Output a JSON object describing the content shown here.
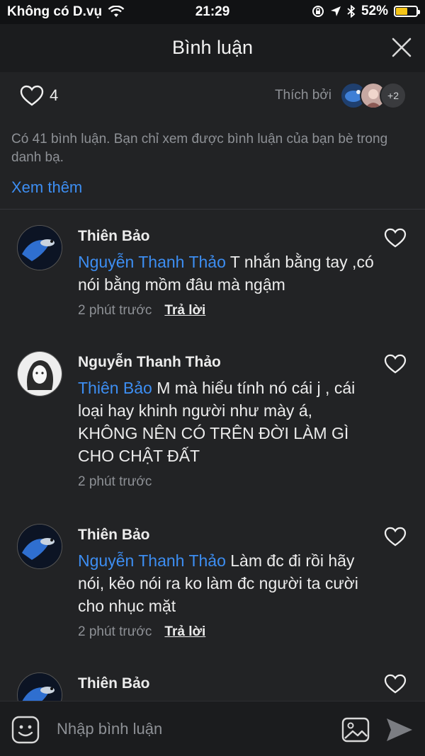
{
  "status_bar": {
    "carrier": "Không có D.vụ",
    "time": "21:29",
    "battery_percent": "52%",
    "battery_level": 0.52
  },
  "header": {
    "title": "Bình luận",
    "close_icon": "close-icon"
  },
  "likes": {
    "count": "4",
    "liked_by_label": "Thích bởi",
    "more_count": "+2"
  },
  "notice": {
    "text": "Có 41 bình luận. Bạn chỉ xem được bình luận của bạn bè trong danh bạ.",
    "see_more": "Xem thêm"
  },
  "comments": [
    {
      "author": "Thiên Bảo",
      "mention": "Nguyễn Thanh Thảo",
      "text": " T nhắn bằng tay ,có nói bằng mồm đâu mà ngậm",
      "time": "2 phút trước",
      "reply": "Trả lời"
    },
    {
      "author": "Nguyễn Thanh Thảo",
      "mention": "Thiên Bảo",
      "text": " M mà hiểu tính nó cái j , cái loại hay khinh người như mày á, KHÔNG NÊN CÓ TRÊN ĐỜI LÀM GÌ CHO CHẬT ĐẤT",
      "time": "2 phút trước",
      "reply": ""
    },
    {
      "author": "Thiên Bảo",
      "mention": "Nguyễn Thanh Thảo",
      "text": " Làm đc đi rồi hãy nói, kẻo nói ra ko làm đc người ta cười cho nhục mặt",
      "time": "2 phút trước",
      "reply": "Trả lời"
    },
    {
      "author": "Thiên Bảo"
    }
  ],
  "composer": {
    "placeholder": "Nhập bình luận"
  },
  "colors": {
    "background": "#222325",
    "accent_blue": "#3d8ef2",
    "muted_text": "#8e9196"
  }
}
